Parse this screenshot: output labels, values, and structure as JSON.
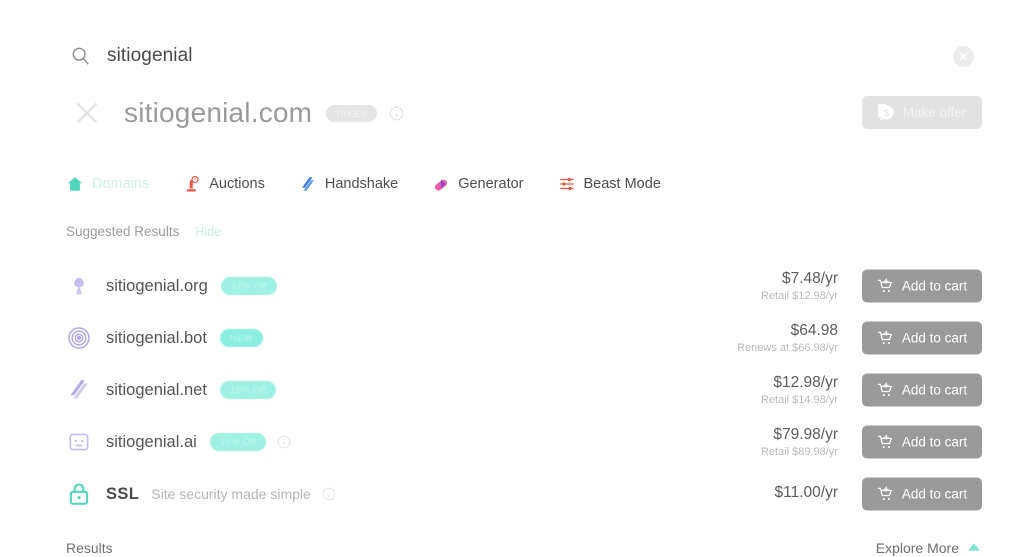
{
  "search": {
    "icon": "search-icon",
    "value": "sitiogenial",
    "placeholder": "",
    "clear_icon": "close-circle-icon"
  },
  "domain_header": {
    "close_icon": "x-icon",
    "name": "sitiogenial.com",
    "status_badge": "TAKEN",
    "info_icon": "info-icon",
    "make_offer": {
      "label": "Make offer",
      "icon": "offer-bubble-icon"
    }
  },
  "tabs": [
    {
      "label": "Domains",
      "icon": "house-icon",
      "active": true,
      "color": "#cdf1ea"
    },
    {
      "label": "Auctions",
      "icon": "gavel-icon",
      "active": false,
      "color": "#e8543f"
    },
    {
      "label": "Handshake",
      "icon": "handshake-icon",
      "active": false,
      "color": "#3b7ddd"
    },
    {
      "label": "Generator",
      "icon": "capsule-icon",
      "active": false,
      "color": "#8e44c8"
    },
    {
      "label": "Beast Mode",
      "icon": "sliders-icon",
      "active": false,
      "color": "#e8543f"
    }
  ],
  "suggested": {
    "title": "Suggested Results",
    "hide_label": "Hide"
  },
  "results": [
    {
      "name": "sitiogenial.org",
      "icon": "org-plant-icon",
      "badge": "42% Off",
      "badge_type": "discount",
      "info": false,
      "price": "$7.48/yr",
      "price_sub": "Retail $12.98/yr",
      "cart_label": "Add to cart"
    },
    {
      "name": "sitiogenial.bot",
      "icon": "bot-target-icon",
      "badge": "NEW",
      "badge_type": "new",
      "info": false,
      "price": "$64.98",
      "price_sub": "Renews at $66.98/yr",
      "cart_label": "Add to cart"
    },
    {
      "name": "sitiogenial.net",
      "icon": "net-swoosh-icon",
      "badge": "15% Off",
      "badge_type": "discount",
      "info": false,
      "price": "$12.98/yr",
      "price_sub": "Retail $14.98/yr",
      "cart_label": "Add to cart"
    },
    {
      "name": "sitiogenial.ai",
      "icon": "ai-robot-icon",
      "badge": "17% Off",
      "badge_type": "discount",
      "info": true,
      "price": "$79.98/yr",
      "price_sub": "Retail $89.98/yr",
      "cart_label": "Add to cart"
    },
    {
      "name": "SSL",
      "icon": "lock-icon",
      "subtitle": "Site security made simple",
      "badge": "",
      "badge_type": "none",
      "info": true,
      "price": "$11.00/yr",
      "price_sub": "",
      "cart_label": "Add to cart"
    }
  ],
  "footer": {
    "results_label": "Results",
    "explore_label": "Explore More",
    "explore_icon": "chevron-up-icon"
  },
  "colors": {
    "accent_teal": "#8aeee0",
    "cart_grey": "#9a9a9a",
    "text_dark": "#4a4a4a"
  }
}
